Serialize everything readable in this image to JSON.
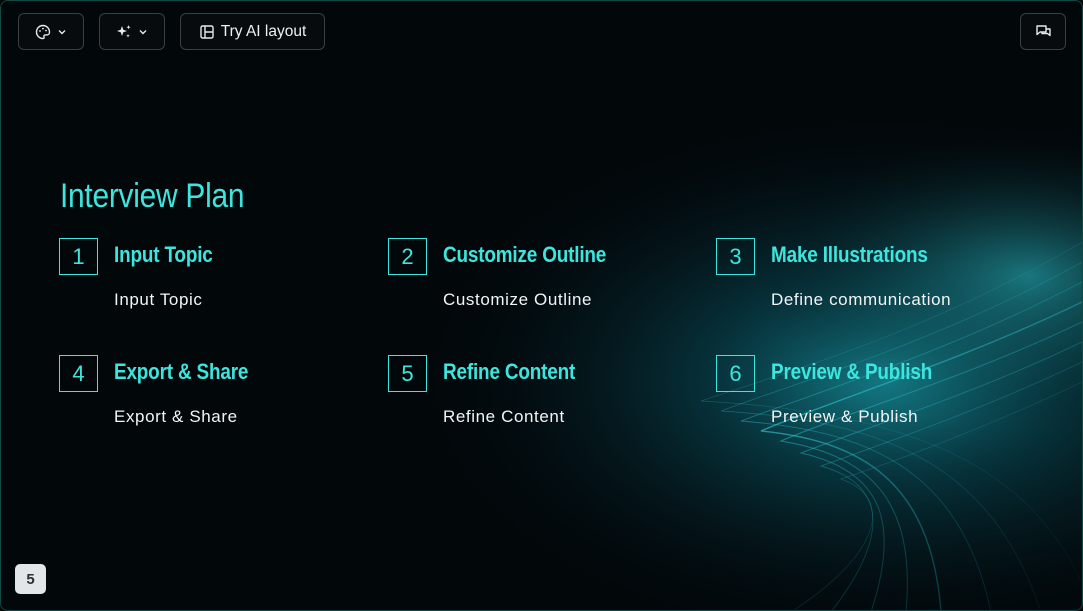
{
  "toolbar": {
    "theme_icon": "palette-icon",
    "ai_icon": "sparkles-icon",
    "layout_icon": "layout-icon",
    "layout_label": "Try AI layout",
    "comments_icon": "comment-icon"
  },
  "slide": {
    "title": "Interview Plan",
    "items": [
      {
        "number": "1",
        "title": "Input Topic",
        "desc": "Input Topic"
      },
      {
        "number": "2",
        "title": "Customize Outline",
        "desc": "Customize Outline"
      },
      {
        "number": "3",
        "title": "Make Illustrations",
        "desc": "Define communication"
      },
      {
        "number": "4",
        "title": "Export & Share",
        "desc": "Export & Share"
      },
      {
        "number": "5",
        "title": "Refine Content",
        "desc": "Refine Content"
      },
      {
        "number": "6",
        "title": "Preview & Publish",
        "desc": "Preview & Publish"
      }
    ],
    "page_number": "5"
  },
  "colors": {
    "accent": "#3ce6de",
    "background": "#02070a",
    "text": "#f2f4f5"
  }
}
